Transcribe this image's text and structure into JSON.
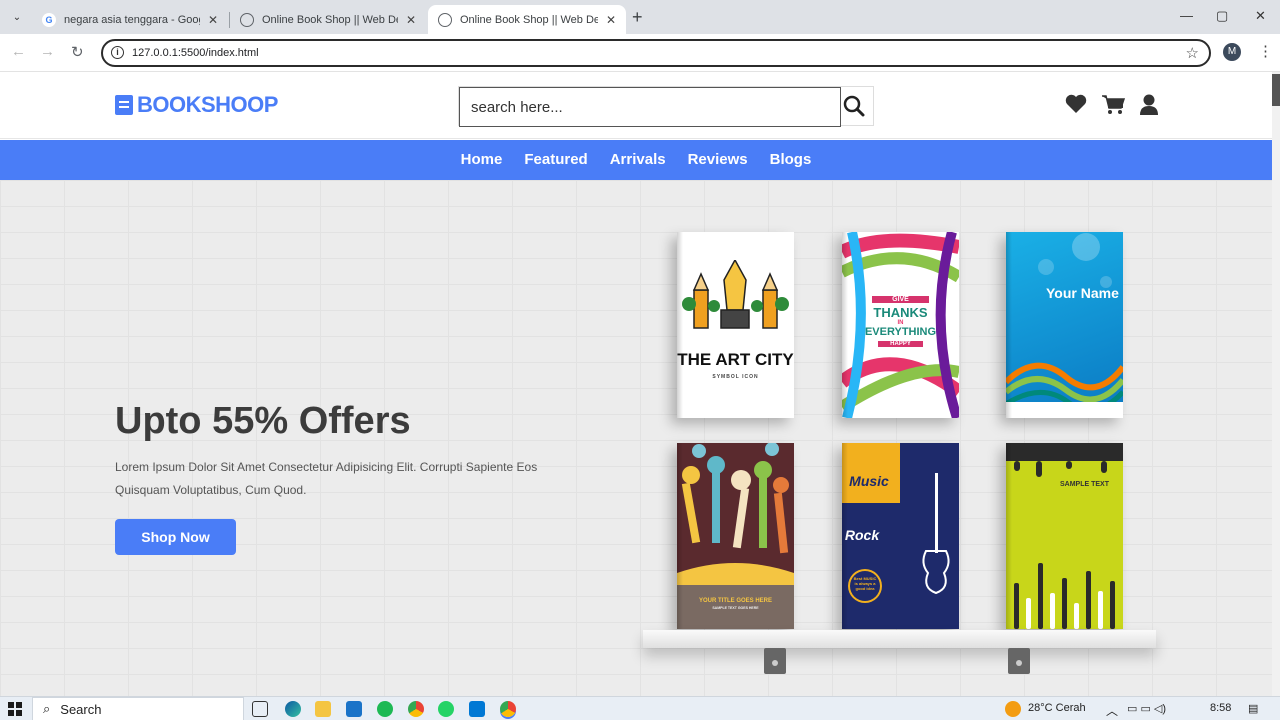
{
  "browser": {
    "tabs": [
      {
        "title": "negara asia tenggara - Google",
        "favicon": "G",
        "active": false
      },
      {
        "title": "Online Book Shop || Web Desig",
        "favicon": "globe",
        "active": false
      },
      {
        "title": "Online Book Shop || Web Desig",
        "favicon": "globe",
        "active": true
      }
    ],
    "url": "127.0.0.1:5500/index.html",
    "profile_initial": "M"
  },
  "site": {
    "logo": "BOOKSHOOP",
    "search_placeholder": "search here...",
    "nav": [
      "Home",
      "Featured",
      "Arrivals",
      "Reviews",
      "Blogs"
    ],
    "accent_color": "#4a7df7"
  },
  "hero": {
    "title": "Upto 55% Offers",
    "description": "Lorem Ipsum Dolor Sit Amet Consectetur Adipisicing Elit. Corrupti Sapiente Eos Quisquam Voluptatibus, Cum Quod.",
    "button": "Shop Now"
  },
  "books": [
    {
      "title": "THE ART CITY",
      "subtitle": "SYMBOL ICON"
    },
    {
      "line1": "GIVE",
      "line2": "THANKS",
      "line3": "IN",
      "line4": "EVERYTHING",
      "line5": "HAPPY"
    },
    {
      "title": "Your Name"
    },
    {
      "title": "YOUR TITLE GOES HERE",
      "subtitle": "SAMPLE TEXT GOES HERE"
    },
    {
      "line1": "Music",
      "line2": "Rock",
      "line3": "Best MUSIC is always a good idea"
    },
    {
      "title": "SAMPLE TEXT"
    }
  ],
  "taskbar": {
    "search": "Search",
    "weather": "28°C Cerah",
    "time": "8:58"
  }
}
